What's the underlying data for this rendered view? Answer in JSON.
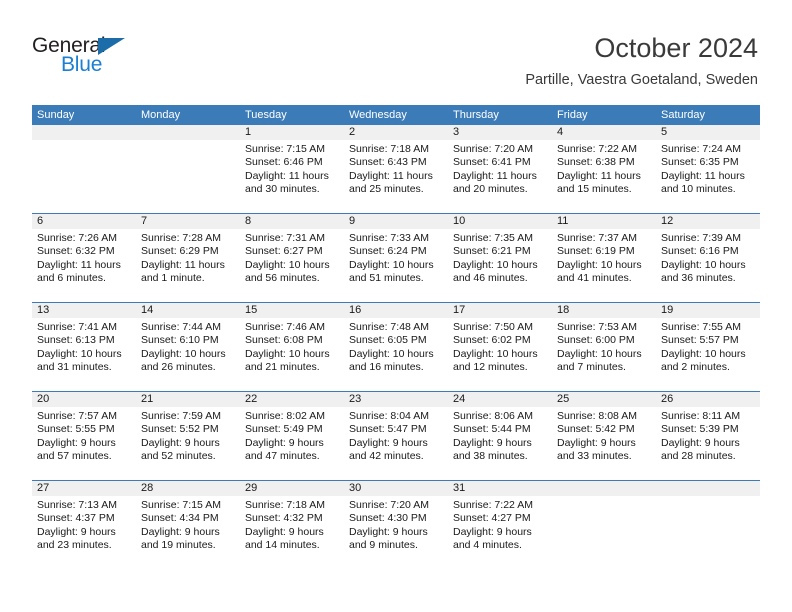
{
  "brand": {
    "name_top": "General",
    "name_bottom": "Blue",
    "color_dark": "#231f20",
    "color_blue": "#1b7fd4",
    "triangle_color": "#1b6ca8"
  },
  "header": {
    "title": "October 2024",
    "subtitle": "Partille, Vaestra Goetaland, Sweden"
  },
  "theme": {
    "header_blue": "#3b7cb8",
    "day_strip_gray": "#f0f0f0",
    "text_color": "#1a1a1a",
    "title_color": "#3a3a3a"
  },
  "calendar": {
    "weekday_headers": [
      "Sunday",
      "Monday",
      "Tuesday",
      "Wednesday",
      "Thursday",
      "Friday",
      "Saturday"
    ],
    "weeks": [
      [
        {
          "day": "",
          "empty": true,
          "lines": []
        },
        {
          "day": "",
          "empty": true,
          "lines": []
        },
        {
          "day": "1",
          "empty": false,
          "lines": [
            "Sunrise: 7:15 AM",
            "Sunset: 6:46 PM",
            "Daylight: 11 hours",
            "and 30 minutes."
          ]
        },
        {
          "day": "2",
          "empty": false,
          "lines": [
            "Sunrise: 7:18 AM",
            "Sunset: 6:43 PM",
            "Daylight: 11 hours",
            "and 25 minutes."
          ]
        },
        {
          "day": "3",
          "empty": false,
          "lines": [
            "Sunrise: 7:20 AM",
            "Sunset: 6:41 PM",
            "Daylight: 11 hours",
            "and 20 minutes."
          ]
        },
        {
          "day": "4",
          "empty": false,
          "lines": [
            "Sunrise: 7:22 AM",
            "Sunset: 6:38 PM",
            "Daylight: 11 hours",
            "and 15 minutes."
          ]
        },
        {
          "day": "5",
          "empty": false,
          "lines": [
            "Sunrise: 7:24 AM",
            "Sunset: 6:35 PM",
            "Daylight: 11 hours",
            "and 10 minutes."
          ]
        }
      ],
      [
        {
          "day": "6",
          "empty": false,
          "lines": [
            "Sunrise: 7:26 AM",
            "Sunset: 6:32 PM",
            "Daylight: 11 hours",
            "and 6 minutes."
          ]
        },
        {
          "day": "7",
          "empty": false,
          "lines": [
            "Sunrise: 7:28 AM",
            "Sunset: 6:29 PM",
            "Daylight: 11 hours",
            "and 1 minute."
          ]
        },
        {
          "day": "8",
          "empty": false,
          "lines": [
            "Sunrise: 7:31 AM",
            "Sunset: 6:27 PM",
            "Daylight: 10 hours",
            "and 56 minutes."
          ]
        },
        {
          "day": "9",
          "empty": false,
          "lines": [
            "Sunrise: 7:33 AM",
            "Sunset: 6:24 PM",
            "Daylight: 10 hours",
            "and 51 minutes."
          ]
        },
        {
          "day": "10",
          "empty": false,
          "lines": [
            "Sunrise: 7:35 AM",
            "Sunset: 6:21 PM",
            "Daylight: 10 hours",
            "and 46 minutes."
          ]
        },
        {
          "day": "11",
          "empty": false,
          "lines": [
            "Sunrise: 7:37 AM",
            "Sunset: 6:19 PM",
            "Daylight: 10 hours",
            "and 41 minutes."
          ]
        },
        {
          "day": "12",
          "empty": false,
          "lines": [
            "Sunrise: 7:39 AM",
            "Sunset: 6:16 PM",
            "Daylight: 10 hours",
            "and 36 minutes."
          ]
        }
      ],
      [
        {
          "day": "13",
          "empty": false,
          "lines": [
            "Sunrise: 7:41 AM",
            "Sunset: 6:13 PM",
            "Daylight: 10 hours",
            "and 31 minutes."
          ]
        },
        {
          "day": "14",
          "empty": false,
          "lines": [
            "Sunrise: 7:44 AM",
            "Sunset: 6:10 PM",
            "Daylight: 10 hours",
            "and 26 minutes."
          ]
        },
        {
          "day": "15",
          "empty": false,
          "lines": [
            "Sunrise: 7:46 AM",
            "Sunset: 6:08 PM",
            "Daylight: 10 hours",
            "and 21 minutes."
          ]
        },
        {
          "day": "16",
          "empty": false,
          "lines": [
            "Sunrise: 7:48 AM",
            "Sunset: 6:05 PM",
            "Daylight: 10 hours",
            "and 16 minutes."
          ]
        },
        {
          "day": "17",
          "empty": false,
          "lines": [
            "Sunrise: 7:50 AM",
            "Sunset: 6:02 PM",
            "Daylight: 10 hours",
            "and 12 minutes."
          ]
        },
        {
          "day": "18",
          "empty": false,
          "lines": [
            "Sunrise: 7:53 AM",
            "Sunset: 6:00 PM",
            "Daylight: 10 hours",
            "and 7 minutes."
          ]
        },
        {
          "day": "19",
          "empty": false,
          "lines": [
            "Sunrise: 7:55 AM",
            "Sunset: 5:57 PM",
            "Daylight: 10 hours",
            "and 2 minutes."
          ]
        }
      ],
      [
        {
          "day": "20",
          "empty": false,
          "lines": [
            "Sunrise: 7:57 AM",
            "Sunset: 5:55 PM",
            "Daylight: 9 hours",
            "and 57 minutes."
          ]
        },
        {
          "day": "21",
          "empty": false,
          "lines": [
            "Sunrise: 7:59 AM",
            "Sunset: 5:52 PM",
            "Daylight: 9 hours",
            "and 52 minutes."
          ]
        },
        {
          "day": "22",
          "empty": false,
          "lines": [
            "Sunrise: 8:02 AM",
            "Sunset: 5:49 PM",
            "Daylight: 9 hours",
            "and 47 minutes."
          ]
        },
        {
          "day": "23",
          "empty": false,
          "lines": [
            "Sunrise: 8:04 AM",
            "Sunset: 5:47 PM",
            "Daylight: 9 hours",
            "and 42 minutes."
          ]
        },
        {
          "day": "24",
          "empty": false,
          "lines": [
            "Sunrise: 8:06 AM",
            "Sunset: 5:44 PM",
            "Daylight: 9 hours",
            "and 38 minutes."
          ]
        },
        {
          "day": "25",
          "empty": false,
          "lines": [
            "Sunrise: 8:08 AM",
            "Sunset: 5:42 PM",
            "Daylight: 9 hours",
            "and 33 minutes."
          ]
        },
        {
          "day": "26",
          "empty": false,
          "lines": [
            "Sunrise: 8:11 AM",
            "Sunset: 5:39 PM",
            "Daylight: 9 hours",
            "and 28 minutes."
          ]
        }
      ],
      [
        {
          "day": "27",
          "empty": false,
          "lines": [
            "Sunrise: 7:13 AM",
            "Sunset: 4:37 PM",
            "Daylight: 9 hours",
            "and 23 minutes."
          ]
        },
        {
          "day": "28",
          "empty": false,
          "lines": [
            "Sunrise: 7:15 AM",
            "Sunset: 4:34 PM",
            "Daylight: 9 hours",
            "and 19 minutes."
          ]
        },
        {
          "day": "29",
          "empty": false,
          "lines": [
            "Sunrise: 7:18 AM",
            "Sunset: 4:32 PM",
            "Daylight: 9 hours",
            "and 14 minutes."
          ]
        },
        {
          "day": "30",
          "empty": false,
          "lines": [
            "Sunrise: 7:20 AM",
            "Sunset: 4:30 PM",
            "Daylight: 9 hours",
            "and 9 minutes."
          ]
        },
        {
          "day": "31",
          "empty": false,
          "lines": [
            "Sunrise: 7:22 AM",
            "Sunset: 4:27 PM",
            "Daylight: 9 hours",
            "and 4 minutes."
          ]
        },
        {
          "day": "",
          "empty": true,
          "lines": []
        },
        {
          "day": "",
          "empty": true,
          "lines": []
        }
      ]
    ]
  }
}
